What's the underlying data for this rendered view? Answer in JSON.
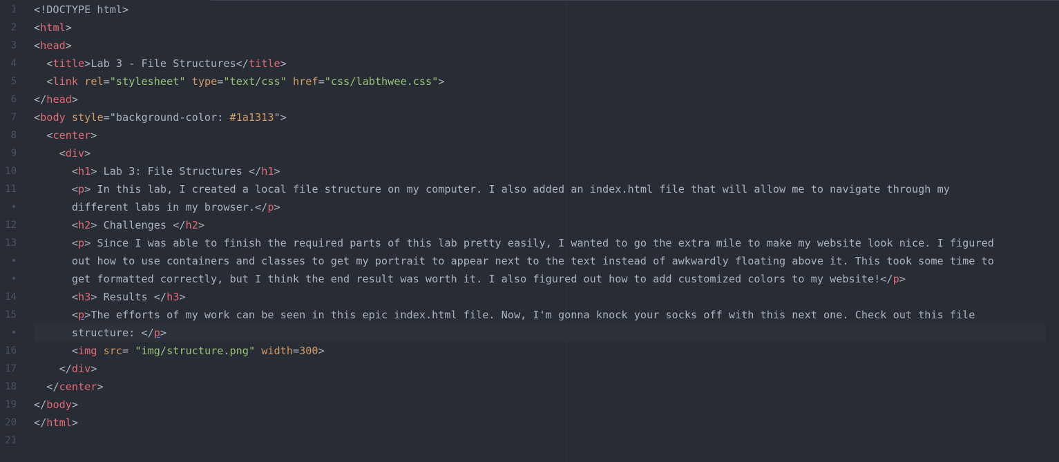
{
  "editor": {
    "language": "HTML",
    "cursor_line_index": 16,
    "lines": [
      {
        "gutter": "1",
        "indent": "",
        "tokens": [
          {
            "t": "pun",
            "v": "<!DOCTYPE html>"
          }
        ]
      },
      {
        "gutter": "2",
        "indent": "",
        "tokens": [
          {
            "t": "pun",
            "v": "<"
          },
          {
            "t": "tag",
            "v": "html"
          },
          {
            "t": "pun",
            "v": ">"
          }
        ]
      },
      {
        "gutter": "3",
        "indent": "",
        "tokens": [
          {
            "t": "pun",
            "v": "<"
          },
          {
            "t": "tag",
            "v": "head"
          },
          {
            "t": "pun",
            "v": ">"
          }
        ]
      },
      {
        "gutter": "4",
        "indent": "  ",
        "tokens": [
          {
            "t": "pun",
            "v": "<"
          },
          {
            "t": "tag",
            "v": "title"
          },
          {
            "t": "pun",
            "v": ">"
          },
          {
            "t": "txt",
            "v": "Lab 3 - File Structures"
          },
          {
            "t": "pun",
            "v": "</"
          },
          {
            "t": "tag",
            "v": "title"
          },
          {
            "t": "pun",
            "v": ">"
          }
        ]
      },
      {
        "gutter": "5",
        "indent": "  ",
        "tokens": [
          {
            "t": "pun",
            "v": "<"
          },
          {
            "t": "tag",
            "v": "link"
          },
          {
            "t": "pun",
            "v": " "
          },
          {
            "t": "attr",
            "v": "rel"
          },
          {
            "t": "pun",
            "v": "="
          },
          {
            "t": "str",
            "v": "\"stylesheet\""
          },
          {
            "t": "pun",
            "v": " "
          },
          {
            "t": "attr",
            "v": "type"
          },
          {
            "t": "pun",
            "v": "="
          },
          {
            "t": "str",
            "v": "\"text/css\""
          },
          {
            "t": "pun",
            "v": " "
          },
          {
            "t": "attr",
            "v": "href"
          },
          {
            "t": "pun",
            "v": "="
          },
          {
            "t": "str",
            "v": "\"css/labthwee.css\""
          },
          {
            "t": "pun",
            "v": ">"
          }
        ]
      },
      {
        "gutter": "6",
        "indent": "",
        "tokens": [
          {
            "t": "pun",
            "v": "</"
          },
          {
            "t": "tag",
            "v": "head"
          },
          {
            "t": "pun",
            "v": ">"
          }
        ]
      },
      {
        "gutter": "7",
        "indent": "",
        "tokens": [
          {
            "t": "pun",
            "v": "<"
          },
          {
            "t": "tag",
            "v": "body"
          },
          {
            "t": "pun",
            "v": " "
          },
          {
            "t": "attr",
            "v": "style"
          },
          {
            "t": "pun",
            "v": "=\"background-color: "
          },
          {
            "t": "num",
            "v": "#1a1313"
          },
          {
            "t": "pun",
            "v": "\">"
          }
        ]
      },
      {
        "gutter": "8",
        "indent": "  ",
        "tokens": [
          {
            "t": "pun",
            "v": "<"
          },
          {
            "t": "tag",
            "v": "center"
          },
          {
            "t": "pun",
            "v": ">"
          }
        ]
      },
      {
        "gutter": "9",
        "indent": "    ",
        "tokens": [
          {
            "t": "pun",
            "v": "<"
          },
          {
            "t": "tag",
            "v": "div"
          },
          {
            "t": "pun",
            "v": ">"
          }
        ]
      },
      {
        "gutter": "10",
        "indent": "      ",
        "tokens": [
          {
            "t": "pun",
            "v": "<"
          },
          {
            "t": "tag",
            "v": "h1"
          },
          {
            "t": "pun",
            "v": ">"
          },
          {
            "t": "txt",
            "v": " Lab 3: File Structures "
          },
          {
            "t": "pun",
            "v": "</"
          },
          {
            "t": "tag",
            "v": "h1"
          },
          {
            "t": "pun",
            "v": ">"
          }
        ]
      },
      {
        "gutter": "11",
        "indent": "      ",
        "tokens": [
          {
            "t": "pun",
            "v": "<"
          },
          {
            "t": "tag",
            "v": "p"
          },
          {
            "t": "pun",
            "v": ">"
          },
          {
            "t": "txt",
            "v": " In this lab, I created a local file structure on my computer. I also added an index.html file that will allow me to navigate through my"
          }
        ]
      },
      {
        "gutter": "•",
        "indent": "      ",
        "soft": true,
        "tokens": [
          {
            "t": "txt",
            "v": "different labs in my browser."
          },
          {
            "t": "pun",
            "v": "</"
          },
          {
            "t": "tag",
            "v": "p"
          },
          {
            "t": "pun",
            "v": ">"
          }
        ]
      },
      {
        "gutter": "12",
        "indent": "      ",
        "tokens": [
          {
            "t": "pun",
            "v": "<"
          },
          {
            "t": "tag",
            "v": "h2"
          },
          {
            "t": "pun",
            "v": ">"
          },
          {
            "t": "txt",
            "v": " Challenges "
          },
          {
            "t": "pun",
            "v": "</"
          },
          {
            "t": "tag",
            "v": "h2"
          },
          {
            "t": "pun",
            "v": ">"
          }
        ]
      },
      {
        "gutter": "13",
        "indent": "      ",
        "tokens": [
          {
            "t": "pun",
            "v": "<"
          },
          {
            "t": "tag",
            "v": "p"
          },
          {
            "t": "pun",
            "v": ">"
          },
          {
            "t": "txt",
            "v": " Since I was able to finish the required parts of this lab pretty easily, I wanted to go the extra mile to make my website look nice. I figured"
          }
        ]
      },
      {
        "gutter": "•",
        "indent": "      ",
        "soft": true,
        "tokens": [
          {
            "t": "txt",
            "v": "out how to use containers and classes to get my portrait to appear next to the text instead of awkwardly floating above it. This took some time to"
          }
        ]
      },
      {
        "gutter": "•",
        "indent": "      ",
        "soft": true,
        "tokens": [
          {
            "t": "txt",
            "v": "get formatted correctly, but I think the end result was worth it. I also figured out how to add customized colors to my website!"
          },
          {
            "t": "pun",
            "v": "</"
          },
          {
            "t": "tag",
            "v": "p"
          },
          {
            "t": "pun",
            "v": ">"
          }
        ]
      },
      {
        "gutter": "14",
        "indent": "      ",
        "tokens": [
          {
            "t": "pun",
            "v": "<"
          },
          {
            "t": "tag",
            "v": "h3"
          },
          {
            "t": "pun",
            "v": ">"
          },
          {
            "t": "txt",
            "v": " Results "
          },
          {
            "t": "pun",
            "v": "</"
          },
          {
            "t": "tag",
            "v": "h3"
          },
          {
            "t": "pun",
            "v": ">"
          }
        ]
      },
      {
        "gutter": "15",
        "indent": "      ",
        "tokens": [
          {
            "t": "pun",
            "v": "<"
          },
          {
            "t": "tag ul",
            "v": "p"
          },
          {
            "t": "pun",
            "v": ">"
          },
          {
            "t": "txt",
            "v": "The efforts of my work can be seen in this epic index.html file. Now, I'm gonna knock your socks off with this next one. Check out this file"
          }
        ]
      },
      {
        "gutter": "•",
        "indent": "      ",
        "soft": true,
        "cursor": true,
        "tokens": [
          {
            "t": "txt",
            "v": "structure: "
          },
          {
            "t": "pun",
            "v": "</"
          },
          {
            "t": "tag ul",
            "v": "p"
          },
          {
            "t": "pun",
            "v": ">"
          }
        ]
      },
      {
        "gutter": "16",
        "indent": "      ",
        "tokens": [
          {
            "t": "pun",
            "v": "<"
          },
          {
            "t": "tag",
            "v": "img"
          },
          {
            "t": "pun",
            "v": " "
          },
          {
            "t": "attr",
            "v": "src"
          },
          {
            "t": "pun",
            "v": "= "
          },
          {
            "t": "str",
            "v": "\"img/structure.png\""
          },
          {
            "t": "pun",
            "v": " "
          },
          {
            "t": "attr",
            "v": "width"
          },
          {
            "t": "pun",
            "v": "="
          },
          {
            "t": "num",
            "v": "300"
          },
          {
            "t": "pun",
            "v": ">"
          }
        ]
      },
      {
        "gutter": "17",
        "indent": "    ",
        "tokens": [
          {
            "t": "pun",
            "v": "</"
          },
          {
            "t": "tag",
            "v": "div"
          },
          {
            "t": "pun",
            "v": ">"
          }
        ]
      },
      {
        "gutter": "18",
        "indent": "  ",
        "tokens": [
          {
            "t": "pun",
            "v": "</"
          },
          {
            "t": "tag",
            "v": "center"
          },
          {
            "t": "pun",
            "v": ">"
          }
        ]
      },
      {
        "gutter": "19",
        "indent": "",
        "tokens": [
          {
            "t": "pun",
            "v": "</"
          },
          {
            "t": "tag",
            "v": "body"
          },
          {
            "t": "pun",
            "v": ">"
          }
        ]
      },
      {
        "gutter": "20",
        "indent": "",
        "tokens": [
          {
            "t": "pun",
            "v": "</"
          },
          {
            "t": "tag",
            "v": "html"
          },
          {
            "t": "pun",
            "v": ">"
          }
        ]
      },
      {
        "gutter": "21",
        "indent": "",
        "tokens": []
      }
    ]
  },
  "colors": {
    "background": "#282c34",
    "cursor_line": "#2c313a",
    "gutter_text": "#4b5263",
    "tag": "#e06c75",
    "attribute": "#d19a66",
    "string": "#98c379",
    "text": "#abb2bf"
  }
}
